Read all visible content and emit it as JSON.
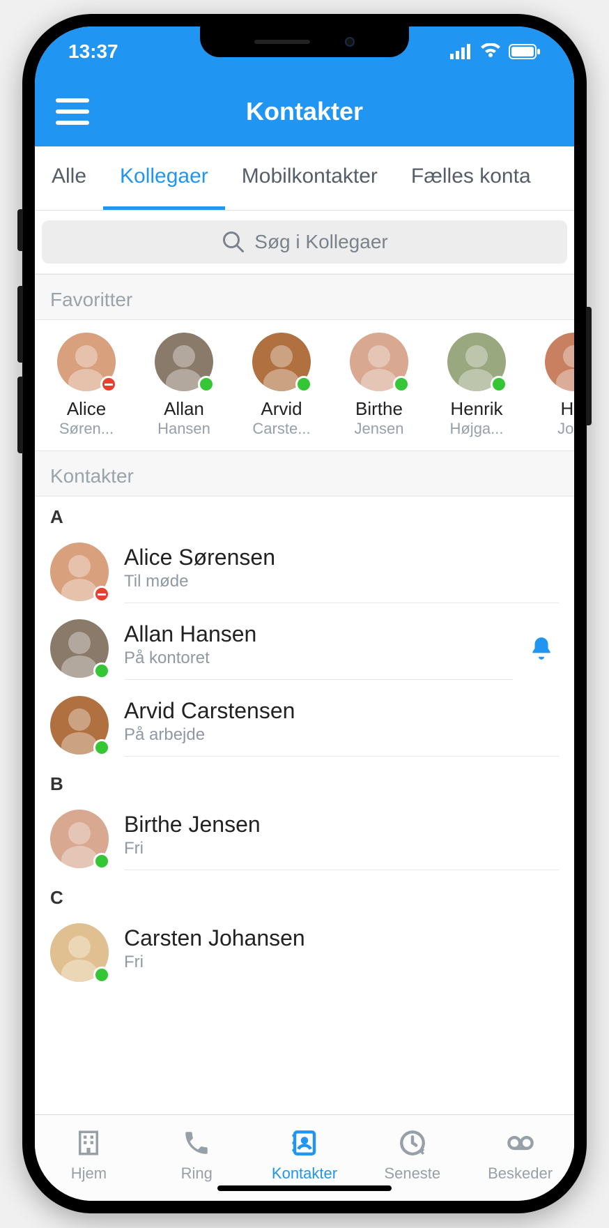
{
  "status": {
    "time": "13:37"
  },
  "header": {
    "title": "Kontakter"
  },
  "tabs": [
    "Alle",
    "Kollegaer",
    "Mobilkontakter",
    "Fælles konta"
  ],
  "activeTab": 1,
  "search": {
    "placeholder": "Søg i Kollegaer"
  },
  "sections": {
    "favorites": "Favoritter",
    "contacts": "Kontakter"
  },
  "favorites": [
    {
      "first": "Alice",
      "last": "Søren...",
      "status": "red",
      "tone": "#d9a07e"
    },
    {
      "first": "Allan",
      "last": "Hansen",
      "status": "green",
      "tone": "#8a7a6a"
    },
    {
      "first": "Arvid",
      "last": "Carste...",
      "status": "green",
      "tone": "#b07040"
    },
    {
      "first": "Birthe",
      "last": "Jensen",
      "status": "green",
      "tone": "#d8a890"
    },
    {
      "first": "Henrik",
      "last": "Højga...",
      "status": "green",
      "tone": "#9aa880"
    },
    {
      "first": "Hel",
      "last": "John",
      "status": "green",
      "tone": "#c88060"
    }
  ],
  "contactGroups": [
    {
      "letter": "A",
      "items": [
        {
          "name": "Alice Sørensen",
          "subtitle": "Til møde",
          "status": "red",
          "bell": false,
          "tone": "#d9a07e"
        },
        {
          "name": "Allan Hansen",
          "subtitle": "På kontoret",
          "status": "green",
          "bell": true,
          "tone": "#8a7a6a"
        },
        {
          "name": "Arvid Carstensen",
          "subtitle": "På arbejde",
          "status": "green",
          "bell": false,
          "tone": "#b07040"
        }
      ]
    },
    {
      "letter": "B",
      "items": [
        {
          "name": "Birthe Jensen",
          "subtitle": "Fri",
          "status": "green",
          "bell": false,
          "tone": "#d8a890"
        }
      ]
    },
    {
      "letter": "C",
      "items": [
        {
          "name": "Carsten Johansen",
          "subtitle": "Fri",
          "status": "green",
          "bell": false,
          "tone": "#e0c090"
        }
      ]
    }
  ],
  "tabbar": [
    {
      "label": "Hjem",
      "icon": "building"
    },
    {
      "label": "Ring",
      "icon": "phone"
    },
    {
      "label": "Kontakter",
      "icon": "contacts"
    },
    {
      "label": "Seneste",
      "icon": "clock"
    },
    {
      "label": "Beskeder",
      "icon": "voicemail"
    }
  ],
  "activeTabbar": 2
}
